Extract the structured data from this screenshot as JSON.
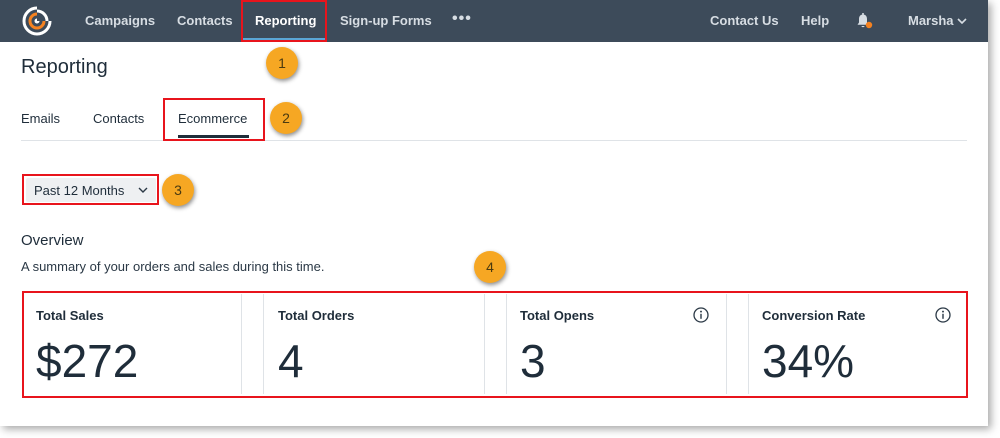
{
  "nav": {
    "items": [
      {
        "label": "Campaigns"
      },
      {
        "label": "Contacts"
      },
      {
        "label": "Reporting"
      },
      {
        "label": "Sign-up Forms"
      }
    ],
    "more_label": "•••",
    "contact_us": "Contact Us",
    "help": "Help",
    "user_name": "Marsha"
  },
  "page": {
    "title": "Reporting",
    "tabs": [
      {
        "label": "Emails"
      },
      {
        "label": "Contacts"
      },
      {
        "label": "Ecommerce",
        "active": true
      }
    ],
    "period_select": {
      "selected": "Past 12 Months"
    }
  },
  "overview": {
    "title": "Overview",
    "subtitle": "A summary of your orders and sales during this time.",
    "cards": [
      {
        "label": "Total Sales",
        "value": "$272"
      },
      {
        "label": "Total Orders",
        "value": "4"
      },
      {
        "label": "Total Opens",
        "value": "3"
      },
      {
        "label": "Conversion Rate",
        "value": "34%"
      }
    ]
  },
  "callouts": [
    "1",
    "2",
    "3",
    "4"
  ],
  "colors": {
    "topbar": "#3d4b5a",
    "highlight": "#e8141c",
    "callout": "#f6a723",
    "brand": "#f58220",
    "active_tab_underline": "#5aa6d6"
  },
  "icons": {
    "logo": "constant-contact-logo-icon",
    "bell": "bell-icon",
    "user_menu": "chevron-down-icon",
    "period": "chevron-down-icon",
    "info": "info-icon"
  }
}
